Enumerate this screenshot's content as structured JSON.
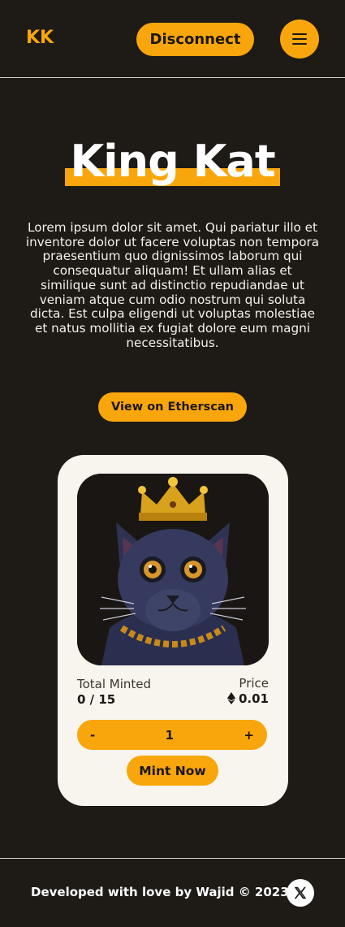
{
  "header": {
    "logo": "KK",
    "disconnect_label": "Disconnect",
    "menu_icon": "hamburger-menu-icon"
  },
  "hero": {
    "title": "King Kat",
    "description": "Lorem ipsum dolor sit amet. Qui pariatur illo et inventore dolor ut facere voluptas non tempora praesentium quo dignissimos laborum qui consequatur aliquam! Et ullam alias et similique sunt ad distinctio repudiandae ut veniam atque cum odio nostrum qui soluta dicta. Est culpa eligendi ut voluptas molestiae et natus mollitia ex fugiat dolore eum magni necessitatibus.",
    "etherscan_label": "View on Etherscan"
  },
  "mint_card": {
    "total_minted_label": "Total Minted",
    "total_minted_value": "0 / 15",
    "price_label": "Price",
    "price_value": "0.01",
    "price_icon": "ethereum-icon",
    "quantity_decrement": "-",
    "quantity_value": "1",
    "quantity_increment": "+",
    "mint_label": "Mint Now"
  },
  "footer": {
    "credit": "Developed with love by Wajid © 2023",
    "social_icon": "x-twitter-icon"
  },
  "colors": {
    "background": "#1e1a16",
    "accent": "#f9a60c",
    "card": "#f8f5ee"
  }
}
